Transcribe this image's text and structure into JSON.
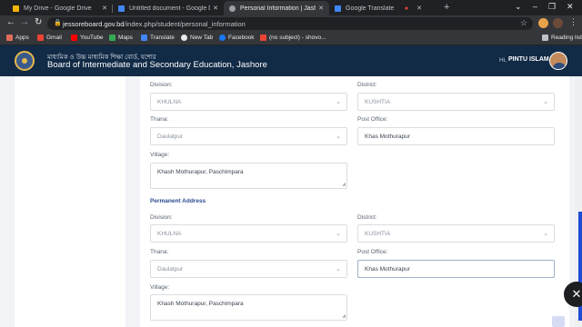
{
  "browser": {
    "tabs": [
      {
        "label": "My Drive - Google Drive",
        "color": "#f4b400"
      },
      {
        "label": "Untitled document - Google Docs",
        "color": "#4285f4"
      },
      {
        "label": "Personal Information | Jashore Board",
        "color": "#9aa0a6"
      },
      {
        "label": "Google Translate",
        "color": "#4285f4"
      }
    ],
    "url_domain": "jessoreboard.gov.bd",
    "url_path": "/index.php/student/personal_information",
    "bookmarks": [
      {
        "label": "Apps",
        "color": "#e06b5b"
      },
      {
        "label": "Gmail",
        "color": "#ea4335"
      },
      {
        "label": "YouTube",
        "color": "#ff0000"
      },
      {
        "label": "Maps",
        "color": "#34a853"
      },
      {
        "label": "Translate",
        "color": "#4285f4"
      },
      {
        "label": "New Tab",
        "color": "#e8eaed"
      },
      {
        "label": "Facebook",
        "color": "#1877f2"
      },
      {
        "label": "(no subject) - shovo...",
        "color": "#ea4335"
      }
    ],
    "reading_list": "Reading list"
  },
  "header": {
    "title_bn": "মাধ্যমিক ও উচ্চ মাধ্যমিক শিক্ষা বোর্ড, যশোর",
    "title": "Board of Intermediate and Secondary Education, Jashore",
    "greeting": "Hi,",
    "username": "PINTU ISLAM"
  },
  "present_address": {
    "division_label": "Division:",
    "division_value": "KHULNA",
    "district_label": "District:",
    "district_value": "KUSHTIA",
    "thana_label": "Thana:",
    "thana_value": "Daulatpur",
    "post_office_label": "Post Office:",
    "post_office_value": "Khas Mothurapur",
    "village_label": "Village:",
    "village_value": "Khash Mothurapur, Paschimpara"
  },
  "permanent_address": {
    "section_title": "Permanent Address",
    "division_label": "Division:",
    "division_value": "KHULNA",
    "district_label": "District:",
    "district_value": "KUSHTIA",
    "thana_label": "Thana:",
    "thana_value": "Daulatpur",
    "post_office_label": "Post Office:",
    "post_office_value": "Khas Mothurapur",
    "village_label": "Village:",
    "village_value": "Khash Mothurapur, Paschimpara"
  }
}
